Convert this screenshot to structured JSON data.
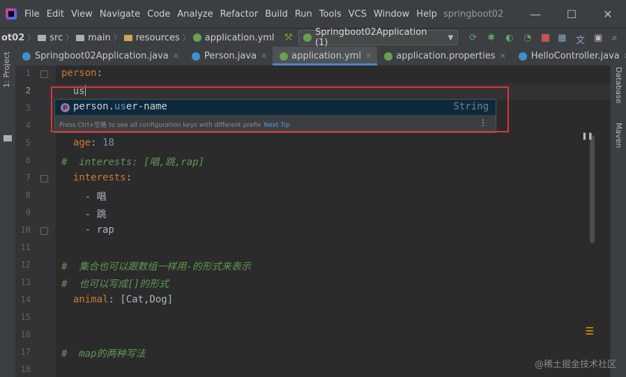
{
  "menubar": {
    "items": [
      "File",
      "Edit",
      "View",
      "Navigate",
      "Code",
      "Analyze",
      "Refactor",
      "Build",
      "Run",
      "Tools",
      "VCS",
      "Window",
      "Help"
    ],
    "project_title": "springboot02",
    "controls": [
      "—",
      "☐",
      "✕"
    ]
  },
  "navbar": {
    "crumbs": [
      "ot02",
      "src",
      "main",
      "resources",
      "application.yml"
    ],
    "run_config": "Springboot02Application (1)"
  },
  "tabs": [
    {
      "label": "Springboot02Application.java",
      "active": false
    },
    {
      "label": "Person.java",
      "active": false
    },
    {
      "label": "application.yml",
      "active": true
    },
    {
      "label": "application.properties",
      "active": false
    },
    {
      "label": "HelloController.java",
      "active": false
    }
  ],
  "left_panel": {
    "label": "1: Project"
  },
  "right_panel": {
    "database": "Database",
    "maven": "Maven"
  },
  "line_numbers": [
    "1",
    "2",
    "3",
    "4",
    "5",
    "6",
    "7",
    "8",
    "9",
    "10",
    "11",
    "12",
    "13",
    "14",
    "15",
    "16",
    "17",
    "18"
  ],
  "code": {
    "l1_key": "person",
    "l1_colon": ":",
    "l2_text": "  us",
    "l5_key": "  age",
    "l5_sep": ": ",
    "l5_val": "18",
    "l6_comment": "#  interests: [唱,跳,rap]",
    "l7_key": "  interests",
    "l7_colon": ":",
    "l8": "    - 唱",
    "l9": "    - 跳",
    "l10": "    - rap",
    "l12_comment": "#  集合也可以跟数组一样用-的形式来表示",
    "l13_comment": "#  也可以写成[]的形式",
    "l14_key": "  animal",
    "l14_rest": ": [Cat,Dog]",
    "l17_comment": "#  map的两种写法"
  },
  "completion": {
    "badge": "p",
    "prefix": "person.",
    "match": "us",
    "suffix": "er-name",
    "type": "String",
    "tip": "Press Ctrl+空格 to see all configuration keys with different prefix",
    "next_tip": "Next Tip",
    "menu": "⋮"
  },
  "watermark": "@稀土掘金技术社区"
}
